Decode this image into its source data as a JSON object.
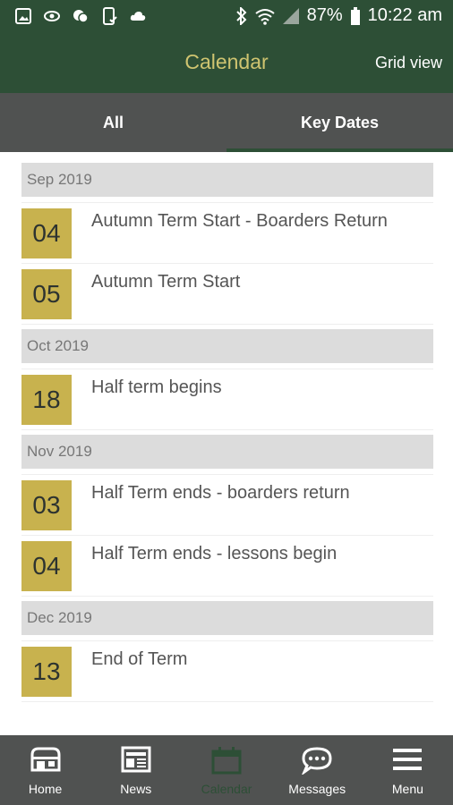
{
  "status_bar": {
    "battery": "87%",
    "time": "10:22 am",
    "icons": [
      "image-icon",
      "sync-icon",
      "chat-icon",
      "phone-check-icon",
      "cloud-icon",
      "bluetooth-icon",
      "wifi-icon",
      "signal-icon",
      "battery-icon"
    ]
  },
  "app_bar": {
    "title": "Calendar",
    "grid_view": "Grid view"
  },
  "tabs": [
    {
      "label": "All",
      "active": false
    },
    {
      "label": "Key Dates",
      "active": true
    }
  ],
  "groups": [
    {
      "month": "Sep 2019",
      "events": [
        {
          "day": "04",
          "title": "Autumn Term Start - Boarders Return"
        },
        {
          "day": "05",
          "title": "Autumn Term Start"
        }
      ]
    },
    {
      "month": "Oct 2019",
      "events": [
        {
          "day": "18",
          "title": "Half term begins"
        }
      ]
    },
    {
      "month": "Nov 2019",
      "events": [
        {
          "day": "03",
          "title": "Half Term ends - boarders return"
        },
        {
          "day": "04",
          "title": "Half Term ends - lessons begin"
        }
      ]
    },
    {
      "month": "Dec 2019",
      "events": [
        {
          "day": "13",
          "title": "End of Term"
        }
      ]
    }
  ],
  "bottom_nav": [
    {
      "label": "Home",
      "icon": "home-icon",
      "active": false
    },
    {
      "label": "News",
      "icon": "news-icon",
      "active": false
    },
    {
      "label": "Calendar",
      "icon": "calendar-icon",
      "active": true
    },
    {
      "label": "Messages",
      "icon": "messages-icon",
      "active": false
    },
    {
      "label": "Menu",
      "icon": "menu-icon",
      "active": false
    }
  ],
  "colors": {
    "header_green": "#2d4f36",
    "title_gold": "#cfc470",
    "date_box": "#c8b24e",
    "tab_bar": "#505251",
    "month_header": "#dcdcdc"
  }
}
